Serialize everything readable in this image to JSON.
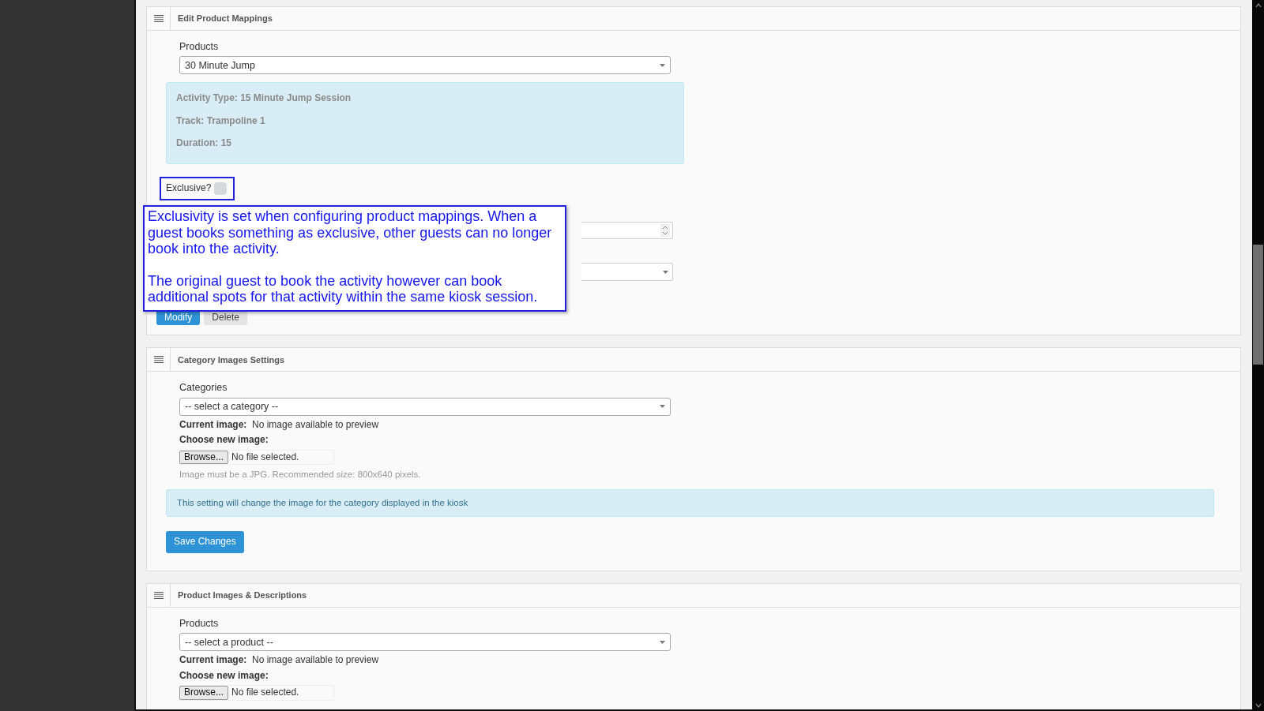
{
  "panels": [
    {
      "kind": "mapping",
      "title": "Edit Product Mappings",
      "select_label": "Products",
      "select_value": "30 Minute Jump",
      "info_lines": [
        "Activity Type: 15 Minute Jump Session",
        "Track: Trampoline 1",
        "Duration: 15"
      ],
      "exclusive": {
        "label": "Exclusive?",
        "checked": false
      },
      "callout": {
        "paragraphs": [
          "Exclusivity is set when configuring product mappings. When a guest books something as exclusive, other guests can no longer book into the activity.",
          "The original guest to book the activity however can book additional spots for that activity within the same kiosk session."
        ]
      },
      "buttons": [
        {
          "label": "Modify",
          "kind": "primary"
        },
        {
          "label": "Delete",
          "kind": "secondary"
        }
      ]
    },
    {
      "kind": "image",
      "title": "Category Images Settings",
      "select_label": "Categories",
      "select_value": "-- select a category --",
      "current_label": "Current image:",
      "current_value": "No image available to preview",
      "choose_label": "Choose new image:",
      "browse_label": "Browse...",
      "file_status": "No file selected.",
      "help": "Image must be a JPG. Recommended size: 800x640 pixels.",
      "note": "This setting will change the image for the category displayed in the kiosk",
      "save_label": "Save Changes"
    },
    {
      "kind": "image",
      "title": "Product Images & Descriptions",
      "select_label": "Products",
      "select_value": "-- select a product --",
      "current_label": "Current image:",
      "current_value": "No image available to preview",
      "choose_label": "Choose new image:",
      "browse_label": "Browse...",
      "file_status": "No file selected."
    }
  ]
}
